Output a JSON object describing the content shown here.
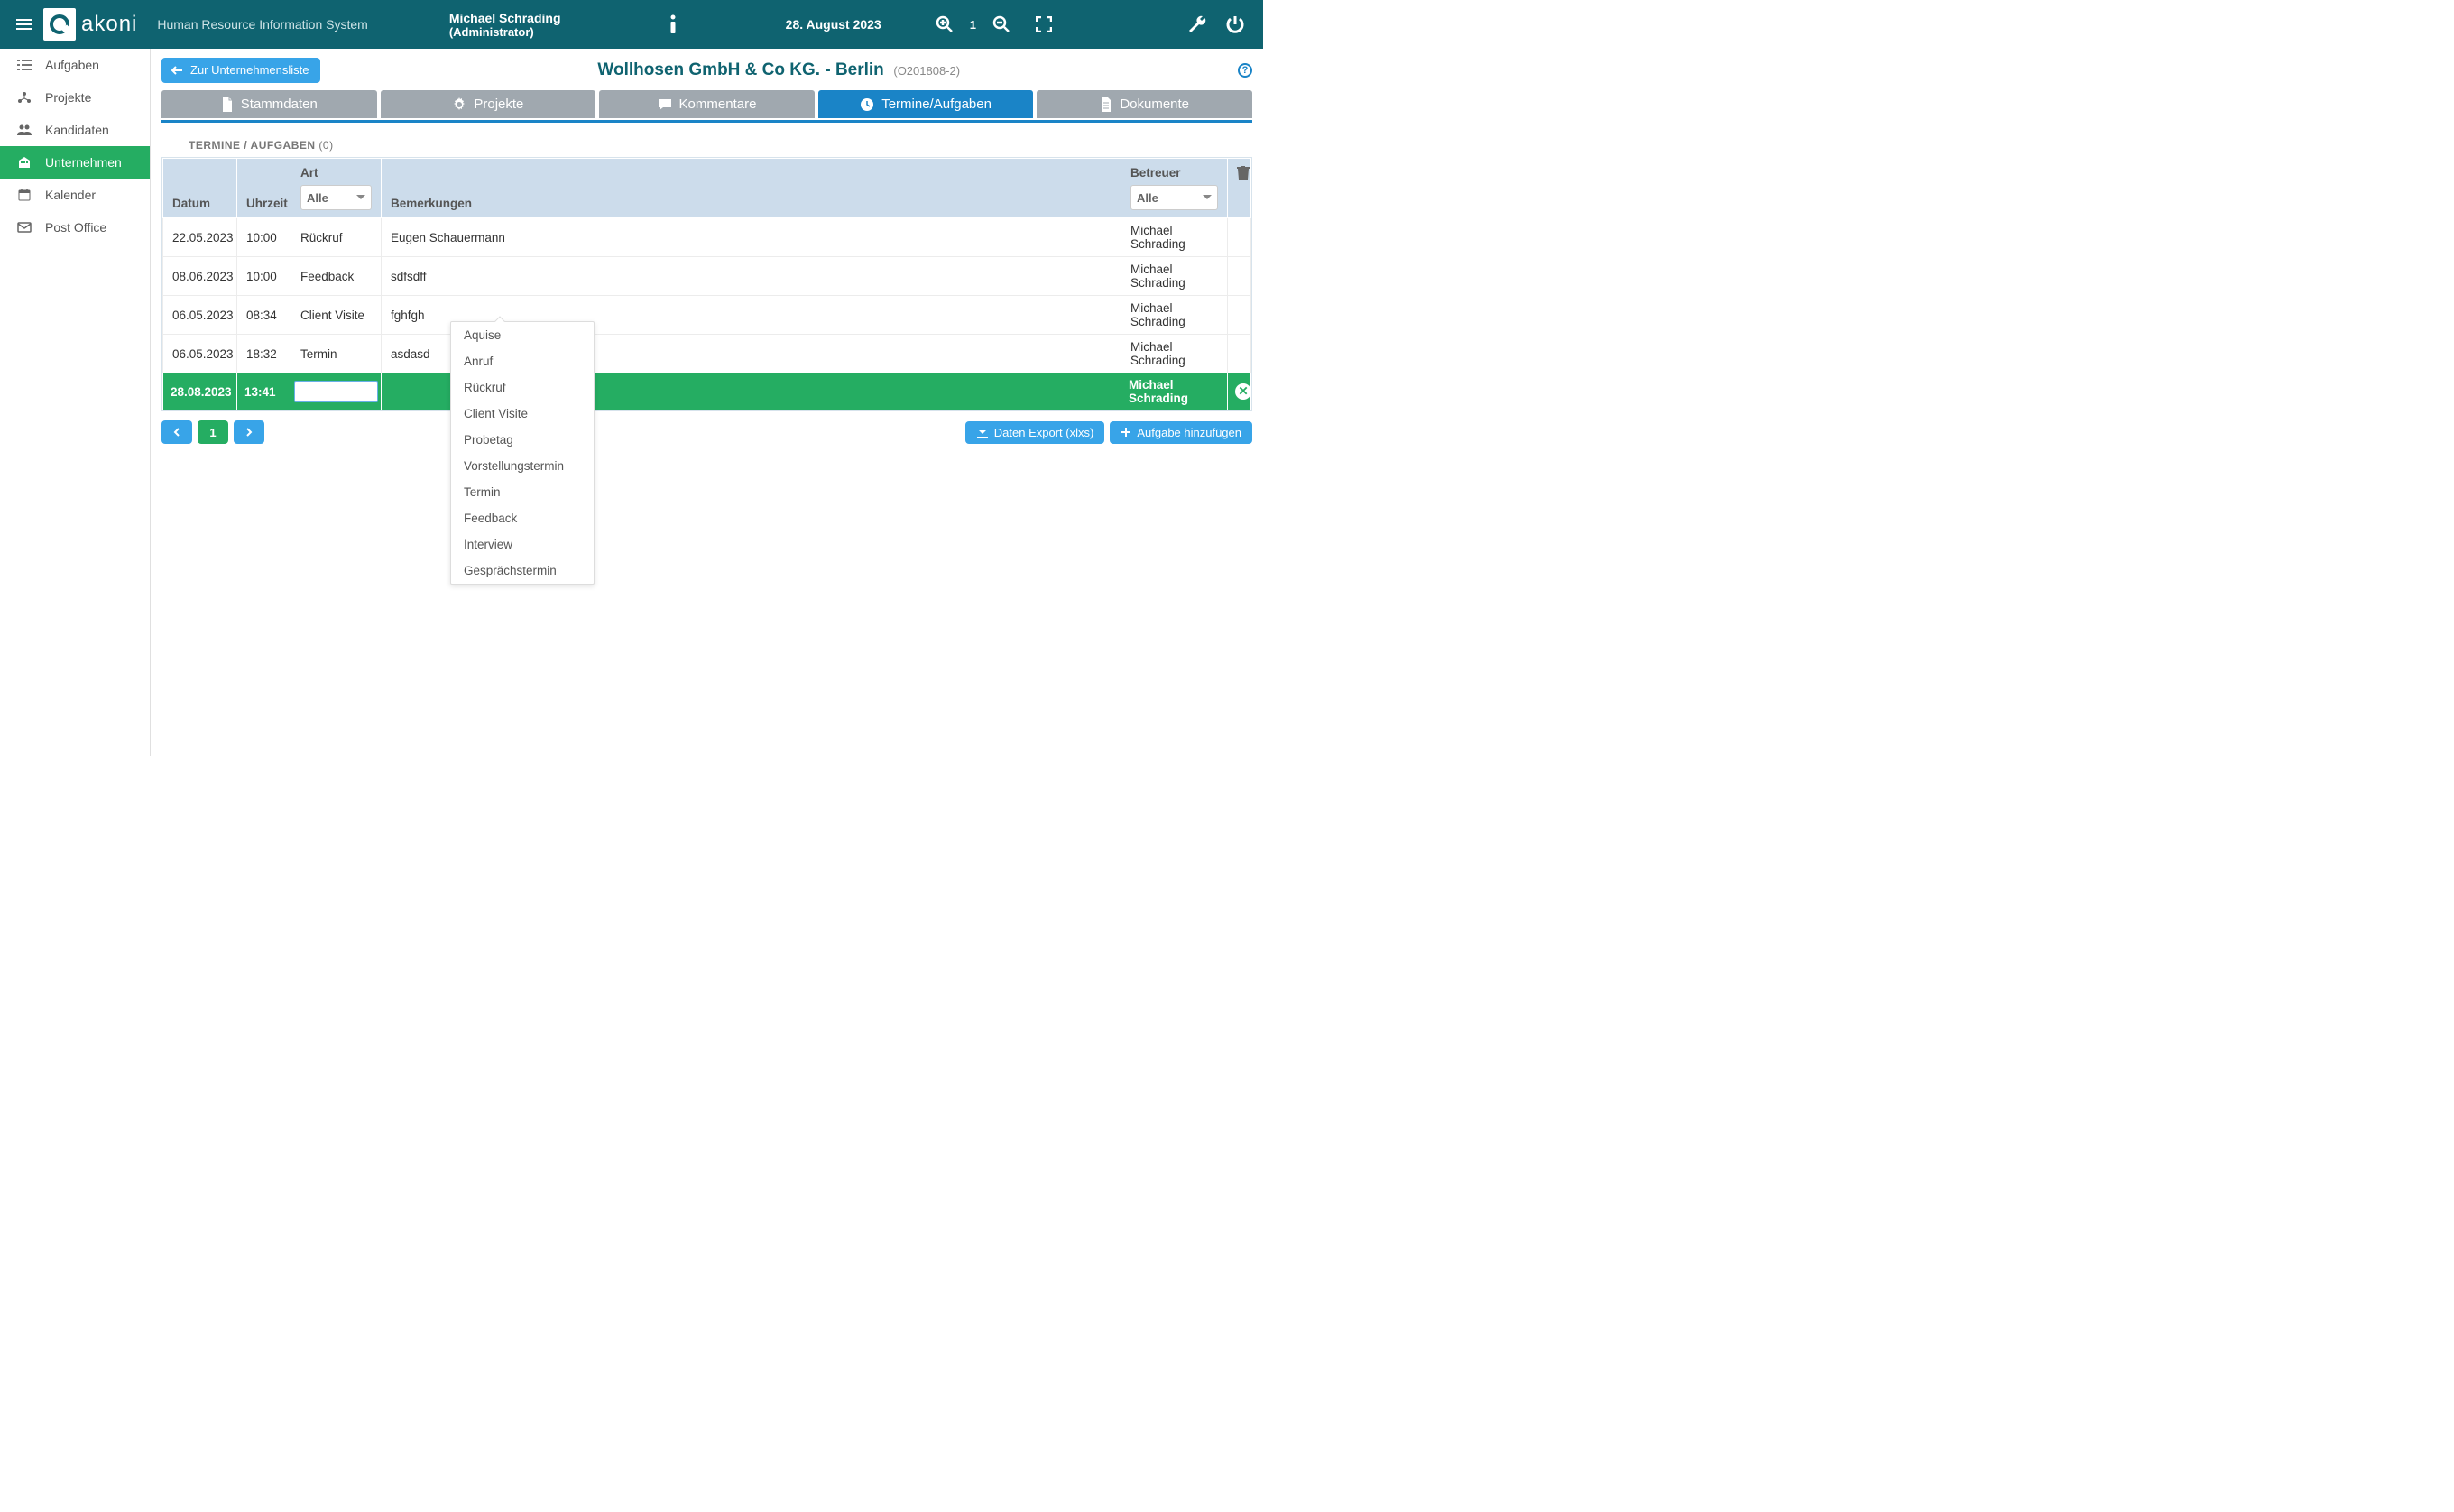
{
  "header": {
    "brand": "akoni",
    "subtitle": "Human Resource Information System",
    "user_name": "Michael Schrading",
    "user_role": "(Administrator)",
    "date": "28. August 2023",
    "zoom": "1"
  },
  "sidebar": {
    "items": [
      {
        "label": "Aufgaben"
      },
      {
        "label": "Projekte"
      },
      {
        "label": "Kandidaten"
      },
      {
        "label": "Unternehmen"
      },
      {
        "label": "Kalender"
      },
      {
        "label": "Post Office"
      }
    ]
  },
  "page": {
    "back_label": "Zur Unternehmensliste",
    "title_main": "Wollhosen GmbH & Co KG. - Berlin",
    "title_sub": "(O201808-2)"
  },
  "tabs": [
    {
      "label": "Stammdaten"
    },
    {
      "label": "Projekte"
    },
    {
      "label": "Kommentare"
    },
    {
      "label": "Termine/Aufgaben"
    },
    {
      "label": "Dokumente"
    }
  ],
  "section": {
    "label": "TERMINE / AUFGABEN",
    "count": "(0)"
  },
  "table": {
    "cols": {
      "datum": "Datum",
      "uhrzeit": "Uhrzeit",
      "art": "Art",
      "bemerkungen": "Bemerkungen",
      "betreuer": "Betreuer"
    },
    "art_filter": "Alle",
    "betreuer_filter": "Alle",
    "rows": [
      {
        "datum": "22.05.2023",
        "uhrzeit": "10:00",
        "art": "Rückruf",
        "bem": "Eugen Schauermann",
        "betr": "Michael Schrading"
      },
      {
        "datum": "08.06.2023",
        "uhrzeit": "10:00",
        "art": "Feedback",
        "bem": "sdfsdff",
        "betr": "Michael Schrading"
      },
      {
        "datum": "06.05.2023",
        "uhrzeit": "08:34",
        "art": "Client Visite",
        "bem": "fghfgh",
        "betr": "Michael Schrading"
      },
      {
        "datum": "06.05.2023",
        "uhrzeit": "18:32",
        "art": "Termin",
        "bem": "asdasd",
        "betr": "Michael Schrading"
      }
    ],
    "new_row": {
      "datum": "28.08.2023",
      "uhrzeit": "13:41",
      "betr": "Michael Schrading"
    }
  },
  "dropdown": {
    "items": [
      "Aquise",
      "Anruf",
      "Rückruf",
      "Client Visite",
      "Probetag",
      "Vorstellungstermin",
      "Termin",
      "Feedback",
      "Interview",
      "Gesprächstermin"
    ]
  },
  "pager": {
    "page": "1"
  },
  "actions": {
    "export": "Daten Export (xlxs)",
    "add": "Aufgabe hinzufügen"
  }
}
